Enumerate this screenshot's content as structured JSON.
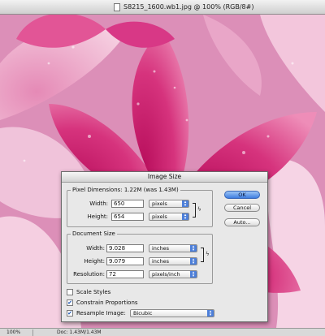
{
  "window": {
    "title": "S8215_1600.wb1.jpg @ 100% (RGB/8#)"
  },
  "status": {
    "zoom": "100%",
    "doc_info": "Doc: 1.43M/1.43M"
  },
  "dialog": {
    "title": "Image Size",
    "pixel_dimensions": {
      "label": "Pixel Dimensions: 1.22M (was 1.43M)",
      "width_label": "Width:",
      "width_value": "650",
      "width_unit": "pixels",
      "height_label": "Height:",
      "height_value": "654",
      "height_unit": "pixels"
    },
    "document_size": {
      "label": "Document Size",
      "width_label": "Width:",
      "width_value": "9.028",
      "width_unit": "inches",
      "height_label": "Height:",
      "height_value": "9.079",
      "height_unit": "inches",
      "resolution_label": "Resolution:",
      "resolution_value": "72",
      "resolution_unit": "pixels/inch"
    },
    "buttons": {
      "ok": "OK",
      "cancel": "Cancel",
      "auto": "Auto..."
    },
    "options": {
      "scale_styles": {
        "label": "Scale Styles",
        "checked": false
      },
      "constrain": {
        "label": "Constrain Proportions",
        "checked": true
      },
      "resample": {
        "label": "Resample Image:",
        "checked": true,
        "method": "Bicubic"
      }
    }
  },
  "colors": {
    "petal_dark": "#c8186a",
    "petal_light": "#f2b6d2",
    "ok_button": "#3f7ee0"
  }
}
